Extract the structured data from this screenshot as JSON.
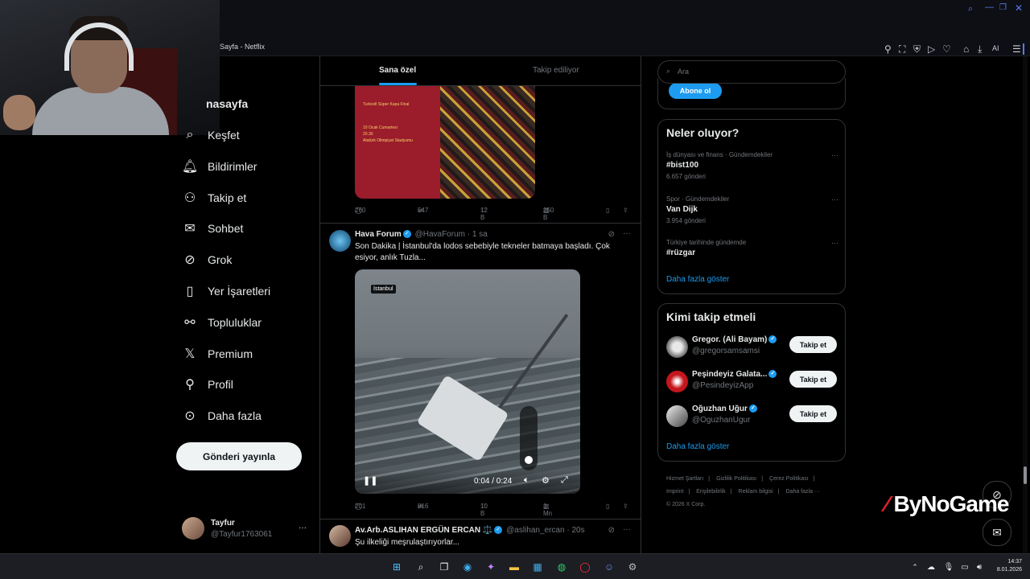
{
  "browser": {
    "tab_title": "Sayfa - Netflix",
    "toolbar_ai_label": "AI"
  },
  "nav": {
    "home": "nasayfa",
    "explore": "Keşfet",
    "notifications": "Bildirimler",
    "follow": "Takip et",
    "chat": "Sohbet",
    "grok": "Grok",
    "bookmarks": "Yer İşaretleri",
    "communities": "Topluluklar",
    "premium": "Premium",
    "profile": "Profil",
    "more": "Daha fazla",
    "post_button": "Gönderi yayınla"
  },
  "account": {
    "name": "Tayfur",
    "handle": "@Tayfur1763061",
    "more": "···"
  },
  "timeline": {
    "tab_for_you": "Sana özel",
    "tab_following": "Takip ediliyor"
  },
  "poster": {
    "line1": "Turkcell Süper Kupa Final",
    "line2": "10 Ocak Cumartesi",
    "line3": "20.30",
    "line4": "Atatürk Olimpiyat Stadyumu"
  },
  "post1_actions": {
    "replies": "260",
    "reposts": "547",
    "likes": "12 B",
    "views": "250 B"
  },
  "post2": {
    "name": "Hava Forum",
    "handle": "@HavaForum",
    "time": "· 1 sa",
    "text": "Son Dakika | İstanbul'da lodos sebebiyle tekneler batmaya başladı. Çok esiyor, anlık Tuzla...",
    "video_badge": "İstanbul",
    "video_time": "0:04 / 0:24",
    "replies": "201",
    "reposts": "816",
    "likes": "10 B",
    "views": "1 Mn"
  },
  "post3": {
    "name": "Av.Arb.ASLIHAN ERGÜN ERCAN ⚖️",
    "handle": "@aslihan_ercan",
    "time": "· 20s",
    "text": "Şu ilkeliği meşrulaştırıyorlar..."
  },
  "right": {
    "search_placeholder": "Ara",
    "subscribe": "Abone ol",
    "trends_title": "Neler oluyor?",
    "trends": [
      {
        "category": "İş dünyası ve finans · Gündemdekiler",
        "topic": "#bist100",
        "count": "6.657 gönderi"
      },
      {
        "category": "Spor · Gündemdekiler",
        "topic": "Van Dijk",
        "count": "3.954 gönderi"
      },
      {
        "category": "Türkiye tarihinde gündemde",
        "topic": "#rüzgar",
        "count": ""
      }
    ],
    "show_more": "Daha fazla göster",
    "who_title": "Kimi takip etmeli",
    "who": [
      {
        "name": "Gregor. (Ali Bayam)",
        "handle": "@gregorsamsamsi",
        "button": "Takip et"
      },
      {
        "name": "Peşindeyiz Galata...",
        "handle": "@PesindeyizApp",
        "button": "Takip et"
      },
      {
        "name": "Oğuzhan Uğur",
        "handle": "@OguzhanUgur",
        "button": "Takip et"
      }
    ],
    "show_more2": "Daha fazla göster",
    "footer": [
      "Hizmet Şartları",
      "|",
      "Gizlilik Politikası",
      "|",
      "Çerez Politikası",
      "|",
      "Imprint",
      "|",
      "Erişilebilirlik",
      "|",
      "Reklam bilgisi",
      "|",
      "Daha fazla ···",
      "© 2026 X Corp."
    ]
  },
  "watermark": "ByNoGame",
  "taskbar": {
    "time": "14:37",
    "date": "8.01.2026"
  }
}
